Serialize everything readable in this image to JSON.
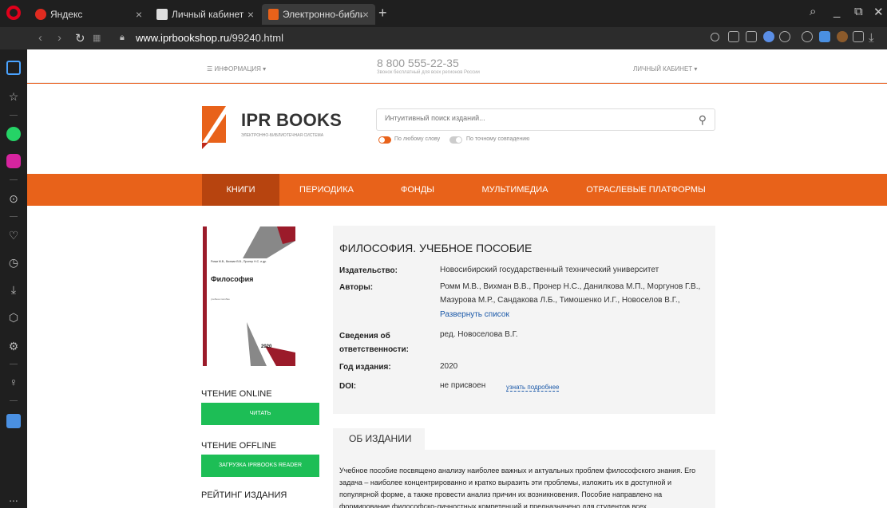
{
  "browser": {
    "tabs": [
      {
        "label": "Яндекс",
        "close": "×"
      },
      {
        "label": "Личный кабинет",
        "close": "×"
      },
      {
        "label": "Электронно-библиотечна",
        "close": "×"
      }
    ],
    "new_tab": "+",
    "url_domain": "www.iprbookshop.ru",
    "url_path": "/99240.html",
    "window_controls": {
      "minimize": "_",
      "restore": "⧉",
      "close": "✕",
      "search": "⌕"
    },
    "sidebar_icons": [
      "home-icon",
      "star-icon",
      "whatsapp-icon",
      "instagram-icon",
      "play-icon",
      "heart-icon",
      "history-icon",
      "download-icon",
      "cube-icon",
      "settings-icon",
      "bulb-icon",
      "translate-icon",
      "more-icon"
    ],
    "sidebar_more": "..."
  },
  "site": {
    "info_menu": "☰ ИНФОРМАЦИЯ ▾",
    "phone": "8 800 555-22-35",
    "phone_note": "Звонок бесплатный для всех регионов России",
    "cabinet": "ЛИЧНЫЙ КАБИНЕТ ▾",
    "logo_text": "IPR BOOKS",
    "logo_sub": "ЭЛЕКТРОННО-БИБЛИОТЕЧНАЯ СИСТЕМА",
    "search_placeholder": "Интуитивный поиск изданий...",
    "toggle_any": "По любому слову",
    "toggle_exact": "По точному совпадению",
    "nav": [
      "КНИГИ",
      "ПЕРИОДИКА",
      "ФОНДЫ",
      "МУЛЬТИМЕДИА",
      "ОТРАСЛЕВЫЕ ПЛАТФОРМЫ"
    ],
    "accent": "#e8621a",
    "active_nav": "#b7440f",
    "green": "#1dbe56"
  },
  "cover": {
    "authors": "Ромм М.В., Вихман В.В., Пронер Н.С. и др.",
    "title": "Философия",
    "subtitle": "учебное пособие",
    "year": "2020"
  },
  "left": {
    "online_heading": "ЧТЕНИЕ ONLINE",
    "read_button": "ЧИТАТЬ",
    "offline_heading": "ЧТЕНИЕ OFFLINE",
    "download_button": "ЗАГРУЗКА IPRBOOKS READER",
    "rating_heading": "РЕЙТИНГ ИЗДАНИЯ"
  },
  "book": {
    "title": "ФИЛОСОФИЯ. УЧЕБНОЕ ПОСОБИЕ",
    "publisher_label": "Издательство:",
    "publisher": "Новосибирский государственный технический университет",
    "authors_label": "Авторы:",
    "authors_line1": "Ромм М.В., Вихман В.В., Пронер Н.С., Данилкова М.П., Моргунов Г.В.,",
    "authors_line2": "Мазурова М.Р., Сандакова Л.Б., Тимошенко И.Г., Новоселов В.Г.,",
    "expand": "Развернуть список",
    "resp_label": "Сведения об ответственности:",
    "resp": "ред. Новоселова В.Г.",
    "year_label": "Год издания:",
    "year": "2020",
    "doi_label": "DOI:",
    "doi": "не присвоен",
    "doi_more": "узнать подробнее"
  },
  "about": {
    "tab": "ОБ ИЗДАНИИ",
    "text": "Учебное пособие посвящено анализу наиболее важных и актуальных проблем философского знания. Его задача – наиболее концентрированно и кратко выразить эти проблемы, изложить их в доступной и популярной форме, а также провести анализ причин их возникновения. Пособие направлено на формирование философско-личностных компетенций и предназначено для студентов всех"
  }
}
